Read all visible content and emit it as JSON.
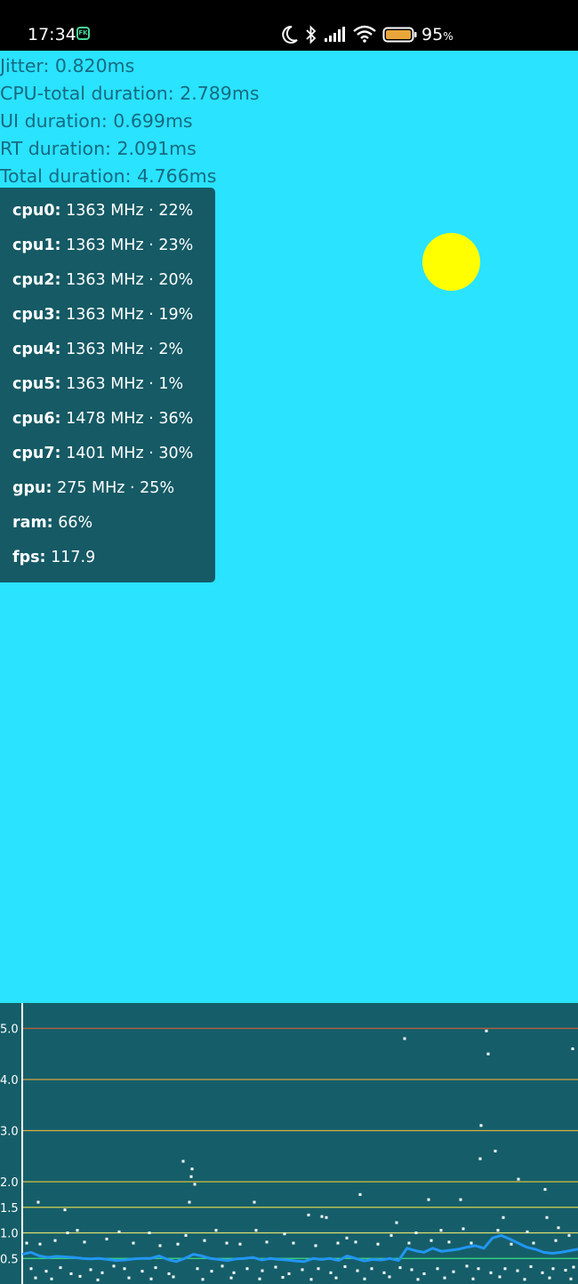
{
  "status_bar": {
    "time": "17:34",
    "app_icon_label": "FK",
    "battery_percent": "95",
    "battery_unit": "%",
    "icons": [
      "moon-icon",
      "bluetooth-icon",
      "signal-icon",
      "wifi-icon",
      "battery-icon"
    ]
  },
  "metrics": [
    "Jitter: 0.820ms",
    "CPU-total duration: 2.789ms",
    "UI duration: 0.699ms",
    "RT duration: 2.091ms",
    "Total duration: 4.766ms"
  ],
  "stats_panel": [
    {
      "label": "cpu0:",
      "value": " 1363 MHz · 22%"
    },
    {
      "label": "cpu1:",
      "value": " 1363 MHz · 23%"
    },
    {
      "label": "cpu2:",
      "value": " 1363 MHz · 20%"
    },
    {
      "label": "cpu3:",
      "value": " 1363 MHz · 19%"
    },
    {
      "label": "cpu4:",
      "value": " 1363 MHz · 2%"
    },
    {
      "label": "cpu5:",
      "value": " 1363 MHz · 1%"
    },
    {
      "label": "cpu6:",
      "value": " 1478 MHz · 36%"
    },
    {
      "label": "cpu7:",
      "value": " 1401 MHz · 30%"
    },
    {
      "label": "gpu:",
      "value": " 275 MHz · 25%"
    },
    {
      "label": "ram:",
      "value": " 66%"
    },
    {
      "label": "fps:",
      "value": " 117.9"
    }
  ],
  "colors": {
    "background": "#2ae3ff",
    "panel": "#155a65",
    "metric_text": "#166a80",
    "sun": "#ffff00",
    "graph_bg": "#155e69",
    "line": "#2196f3",
    "green_line": "#3ddc84"
  },
  "chart_data": {
    "type": "scatter",
    "y_ticks": [
      "5.0",
      "4.0",
      "3.0",
      "2.0",
      "1.5",
      "1.0",
      "0.5"
    ],
    "y_tick_values": [
      5.0,
      4.0,
      3.0,
      2.0,
      1.5,
      1.0,
      0.5
    ],
    "threshold_lines": [
      {
        "value": 5.0,
        "color": "#c0603c"
      },
      {
        "value": 4.0,
        "color": "#d7a340"
      },
      {
        "value": 3.0,
        "color": "#d7b040"
      },
      {
        "value": 2.0,
        "color": "#d8c040"
      },
      {
        "value": 1.5,
        "color": "#d8d050"
      },
      {
        "value": 1.0,
        "color": "#e0e070"
      },
      {
        "value": 0.5,
        "color": "#3ddc84"
      }
    ],
    "line_series": [
      0.58,
      0.62,
      0.55,
      0.52,
      0.54,
      0.53,
      0.52,
      0.5,
      0.49,
      0.5,
      0.48,
      0.46,
      0.47,
      0.49,
      0.5,
      0.5,
      0.55,
      0.48,
      0.44,
      0.5,
      0.58,
      0.55,
      0.5,
      0.48,
      0.46,
      0.49,
      0.5,
      0.52,
      0.47,
      0.5,
      0.48,
      0.47,
      0.45,
      0.44,
      0.5,
      0.48,
      0.5,
      0.46,
      0.55,
      0.5,
      0.45,
      0.48,
      0.47,
      0.5,
      0.46,
      0.7,
      0.65,
      0.62,
      0.7,
      0.64,
      0.66,
      0.68,
      0.72,
      0.75,
      0.7,
      0.9,
      0.95,
      0.88,
      0.8,
      0.72,
      0.68,
      0.62,
      0.6,
      0.62,
      0.65,
      0.68
    ],
    "scatter_points": [
      [
        455,
        4.8
      ],
      [
        547,
        4.95
      ],
      [
        549,
        4.5
      ],
      [
        644,
        4.6
      ],
      [
        541,
        3.1
      ],
      [
        557,
        2.6
      ],
      [
        540,
        2.45
      ],
      [
        206,
        2.4
      ],
      [
        216,
        2.25
      ],
      [
        215,
        2.1
      ],
      [
        219,
        1.95
      ],
      [
        583,
        2.05
      ],
      [
        405,
        1.75
      ],
      [
        613,
        1.85
      ],
      [
        43,
        1.6
      ],
      [
        73,
        1.45
      ],
      [
        213,
        1.6
      ],
      [
        286,
        1.6
      ],
      [
        482,
        1.65
      ],
      [
        518,
        1.65
      ],
      [
        347,
        1.35
      ],
      [
        362,
        1.32
      ],
      [
        367,
        1.3
      ],
      [
        566,
        1.3
      ],
      [
        446,
        1.2
      ],
      [
        628,
        1.1
      ],
      [
        615,
        1.3
      ],
      [
        76,
        1.0
      ],
      [
        87,
        1.05
      ],
      [
        134,
        1.02
      ],
      [
        168,
        1.0
      ],
      [
        209,
        0.95
      ],
      [
        243,
        1.05
      ],
      [
        288,
        1.05
      ],
      [
        320,
        0.98
      ],
      [
        390,
        0.9
      ],
      [
        440,
        0.95
      ],
      [
        468,
        1.0
      ],
      [
        496,
        1.05
      ],
      [
        521,
        1.08
      ],
      [
        560,
        1.05
      ],
      [
        593,
        1.02
      ],
      [
        640,
        0.95
      ],
      [
        30,
        0.8
      ],
      [
        45,
        0.78
      ],
      [
        62,
        0.85
      ],
      [
        95,
        0.82
      ],
      [
        120,
        0.88
      ],
      [
        150,
        0.8
      ],
      [
        180,
        0.75
      ],
      [
        200,
        0.78
      ],
      [
        230,
        0.85
      ],
      [
        255,
        0.8
      ],
      [
        270,
        0.78
      ],
      [
        300,
        0.82
      ],
      [
        330,
        0.8
      ],
      [
        355,
        0.75
      ],
      [
        380,
        0.8
      ],
      [
        400,
        0.82
      ],
      [
        425,
        0.78
      ],
      [
        460,
        0.8
      ],
      [
        485,
        0.85
      ],
      [
        505,
        0.82
      ],
      [
        530,
        0.8
      ],
      [
        575,
        0.78
      ],
      [
        600,
        0.8
      ],
      [
        625,
        0.85
      ],
      [
        35,
        0.3
      ],
      [
        52,
        0.25
      ],
      [
        68,
        0.32
      ],
      [
        80,
        0.2
      ],
      [
        102,
        0.28
      ],
      [
        115,
        0.22
      ],
      [
        128,
        0.35
      ],
      [
        140,
        0.3
      ],
      [
        160,
        0.25
      ],
      [
        175,
        0.32
      ],
      [
        190,
        0.2
      ],
      [
        222,
        0.3
      ],
      [
        238,
        0.25
      ],
      [
        250,
        0.35
      ],
      [
        263,
        0.22
      ],
      [
        278,
        0.3
      ],
      [
        295,
        0.26
      ],
      [
        310,
        0.33
      ],
      [
        325,
        0.2
      ],
      [
        340,
        0.28
      ],
      [
        358,
        0.3
      ],
      [
        372,
        0.22
      ],
      [
        388,
        0.34
      ],
      [
        402,
        0.26
      ],
      [
        418,
        0.3
      ],
      [
        432,
        0.22
      ],
      [
        450,
        0.32
      ],
      [
        463,
        0.28
      ],
      [
        477,
        0.2
      ],
      [
        492,
        0.3
      ],
      [
        510,
        0.24
      ],
      [
        525,
        0.35
      ],
      [
        538,
        0.3
      ],
      [
        552,
        0.22
      ],
      [
        568,
        0.3
      ],
      [
        582,
        0.26
      ],
      [
        597,
        0.34
      ],
      [
        610,
        0.22
      ],
      [
        622,
        0.3
      ],
      [
        636,
        0.27
      ],
      [
        645,
        0.33
      ],
      [
        40,
        0.12
      ],
      [
        58,
        0.1
      ],
      [
        90,
        0.15
      ],
      [
        110,
        0.08
      ],
      [
        145,
        0.12
      ],
      [
        170,
        0.1
      ],
      [
        195,
        0.14
      ],
      [
        228,
        0.09
      ],
      [
        260,
        0.12
      ],
      [
        292,
        0.1
      ],
      [
        318,
        0.13
      ],
      [
        350,
        0.09
      ],
      [
        378,
        0.12
      ],
      [
        410,
        0.1
      ],
      [
        438,
        0.14
      ],
      [
        470,
        0.09
      ],
      [
        500,
        0.12
      ],
      [
        532,
        0.1
      ],
      [
        562,
        0.14
      ],
      [
        590,
        0.09
      ],
      [
        618,
        0.12
      ],
      [
        642,
        0.1
      ]
    ]
  }
}
